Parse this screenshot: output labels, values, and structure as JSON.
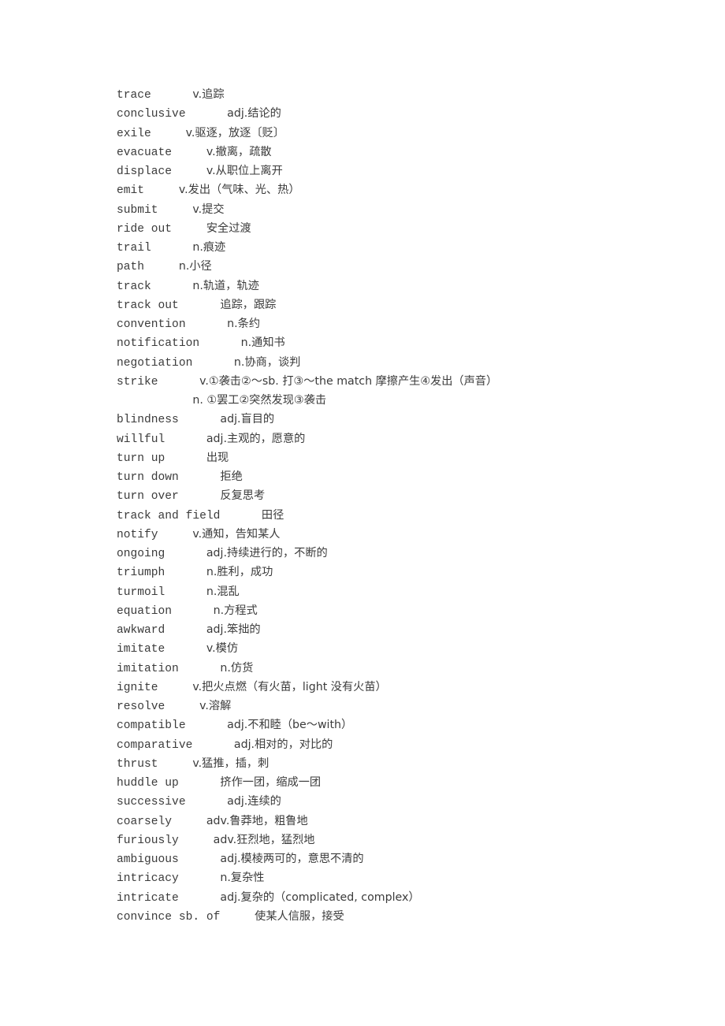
{
  "page": {
    "background_color": "#ffffff",
    "text_color": "#3b3b3b",
    "kind": "vocabulary-glossary-page"
  },
  "entries": [
    {
      "headword": "trace",
      "gap": "      ",
      "definition": "v.追踪"
    },
    {
      "headword": "conclusive",
      "gap": "      ",
      "definition": "adj.结论的"
    },
    {
      "headword": "exile",
      "gap": "     ",
      "definition": "v.驱逐，放逐〔贬〕"
    },
    {
      "headword": "evacuate",
      "gap": "     ",
      "definition": "v.撤离，疏散"
    },
    {
      "headword": "displace",
      "gap": "     ",
      "definition": "v.从职位上离开"
    },
    {
      "headword": "emit",
      "gap": "     ",
      "definition": "v.发出（气味、光、热）"
    },
    {
      "headword": "submit",
      "gap": "     ",
      "definition": "v.提交"
    },
    {
      "headword": "ride out",
      "gap": "     ",
      "definition": "安全过渡"
    },
    {
      "headword": "trail",
      "gap": "      ",
      "definition": "n.痕迹"
    },
    {
      "headword": "path",
      "gap": "     ",
      "definition": "n.小径"
    },
    {
      "headword": "track",
      "gap": "      ",
      "definition": "n.轨道，轨迹"
    },
    {
      "headword": "track out",
      "gap": "      ",
      "definition": "追踪，跟踪"
    },
    {
      "headword": "convention",
      "gap": "      ",
      "definition": "n.条约"
    },
    {
      "headword": "notification",
      "gap": "      ",
      "definition": "n.通知书"
    },
    {
      "headword": "negotiation",
      "gap": "      ",
      "definition": "n.协商，谈判"
    },
    {
      "headword": "strike",
      "gap": "      ",
      "definition": "v.①袭击②～sb. 打③～the match 摩擦产生④发出（声音）"
    },
    {
      "headword": "",
      "gap": "           ",
      "definition": "n. ①罢工②突然发现③袭击",
      "continuation": true
    },
    {
      "headword": "blindness",
      "gap": "      ",
      "definition": "adj.盲目的"
    },
    {
      "headword": "willful",
      "gap": "      ",
      "definition": "adj.主观的，愿意的"
    },
    {
      "headword": "turn up",
      "gap": "      ",
      "definition": "出现"
    },
    {
      "headword": "turn down",
      "gap": "      ",
      "definition": "拒绝"
    },
    {
      "headword": "turn over",
      "gap": "      ",
      "definition": "反复思考"
    },
    {
      "headword": "track and field",
      "gap": "      ",
      "definition": "田径"
    },
    {
      "headword": "notify",
      "gap": "     ",
      "definition": "v.通知，告知某人"
    },
    {
      "headword": "ongoing",
      "gap": "      ",
      "definition": "adj.持续进行的，不断的"
    },
    {
      "headword": "triumph",
      "gap": "      ",
      "definition": "n.胜利，成功"
    },
    {
      "headword": "turmoil",
      "gap": "      ",
      "definition": "n.混乱"
    },
    {
      "headword": "equation",
      "gap": "      ",
      "definition": "n.方程式"
    },
    {
      "headword": "awkward",
      "gap": "      ",
      "definition": "adj.笨拙的"
    },
    {
      "headword": "imitate",
      "gap": "      ",
      "definition": "v.模仿"
    },
    {
      "headword": "imitation",
      "gap": "      ",
      "definition": "n.仿货"
    },
    {
      "headword": "ignite",
      "gap": "     ",
      "definition": "v.把火点燃（有火苗，light 没有火苗）"
    },
    {
      "headword": "resolve",
      "gap": "     ",
      "definition": "v.溶解"
    },
    {
      "headword": "compatible",
      "gap": "      ",
      "definition": "adj.不和睦（be～with）"
    },
    {
      "headword": "comparative",
      "gap": "      ",
      "definition": "adj.相对的，对比的"
    },
    {
      "headword": "thrust",
      "gap": "     ",
      "definition": "v.猛推，插，刺"
    },
    {
      "headword": "huddle up",
      "gap": "      ",
      "definition": "挤作一团，缩成一团"
    },
    {
      "headword": "successive",
      "gap": "      ",
      "definition": "adj.连续的"
    },
    {
      "headword": "coarsely",
      "gap": "     ",
      "definition": "adv.鲁莽地，粗鲁地"
    },
    {
      "headword": "furiously",
      "gap": "     ",
      "definition": "adv.狂烈地，猛烈地"
    },
    {
      "headword": "ambiguous",
      "gap": "      ",
      "definition": "adj.模棱两可的，意思不清的"
    },
    {
      "headword": "intricacy",
      "gap": "      ",
      "definition": "n.复杂性"
    },
    {
      "headword": "intricate",
      "gap": "      ",
      "definition": "adj.复杂的（complicated, complex）"
    },
    {
      "headword": "convince sb. of",
      "gap": "     ",
      "definition": "使某人信服，接受"
    }
  ]
}
